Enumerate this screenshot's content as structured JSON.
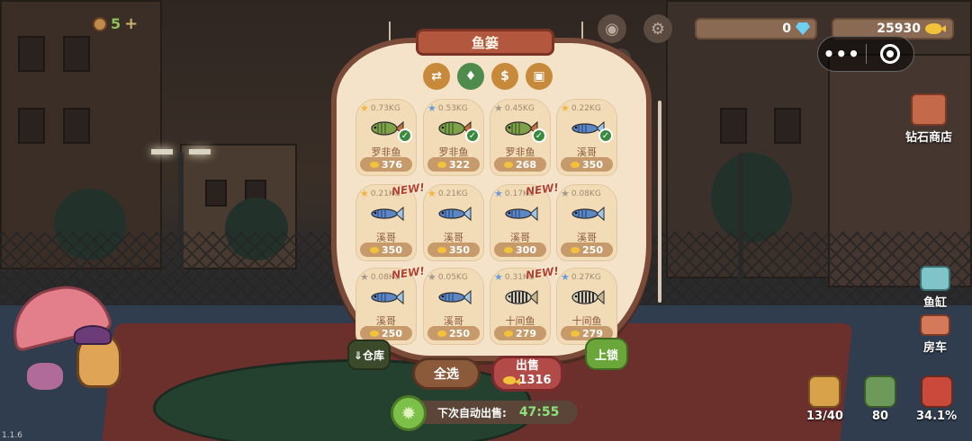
{
  "hud": {
    "cookie_count": "5",
    "plus": "+",
    "diamonds": "0",
    "coins": "25930",
    "help": "?",
    "capsule_menu": "•••"
  },
  "panel": {
    "title": "鱼篓",
    "tools": [
      {
        "icon": "swap-icon",
        "glyph": "⇄"
      },
      {
        "icon": "diamond-filter-icon",
        "glyph": "♦"
      },
      {
        "icon": "coin-filter-icon",
        "glyph": "$"
      },
      {
        "icon": "bag-filter-icon",
        "glyph": "▣"
      }
    ]
  },
  "fish": [
    {
      "weight": "0.73KG",
      "name": "罗非鱼",
      "price": "376",
      "checked": true,
      "new": false,
      "star": "gold",
      "kind": "tilapia"
    },
    {
      "weight": "0.53KG",
      "name": "罗非鱼",
      "price": "322",
      "checked": true,
      "new": false,
      "star": "blue",
      "kind": "tilapia"
    },
    {
      "weight": "0.45KG",
      "name": "罗非鱼",
      "price": "268",
      "checked": true,
      "new": false,
      "star": "gray",
      "kind": "tilapia"
    },
    {
      "weight": "0.22KG",
      "name": "溪哥",
      "price": "350",
      "checked": true,
      "new": false,
      "star": "gold",
      "kind": "creek"
    },
    {
      "weight": "0.21KG",
      "name": "溪哥",
      "price": "350",
      "checked": false,
      "new": true,
      "star": "gold",
      "kind": "creek"
    },
    {
      "weight": "0.21KG",
      "name": "溪哥",
      "price": "350",
      "checked": false,
      "new": false,
      "star": "gold",
      "kind": "creek"
    },
    {
      "weight": "0.17KG",
      "name": "溪哥",
      "price": "300",
      "checked": false,
      "new": true,
      "star": "blue",
      "kind": "creek"
    },
    {
      "weight": "0.08KG",
      "name": "溪哥",
      "price": "250",
      "checked": false,
      "new": false,
      "star": "gray",
      "kind": "creek"
    },
    {
      "weight": "0.08KG",
      "name": "溪哥",
      "price": "250",
      "checked": false,
      "new": true,
      "star": "gray",
      "kind": "creek"
    },
    {
      "weight": "0.05KG",
      "name": "溪哥",
      "price": "250",
      "checked": false,
      "new": false,
      "star": "gray",
      "kind": "creek"
    },
    {
      "weight": "0.31KG",
      "name": "十间鱼",
      "price": "279",
      "checked": false,
      "new": true,
      "star": "blue",
      "kind": "striped"
    },
    {
      "weight": "0.27KG",
      "name": "十间鱼",
      "price": "279",
      "checked": false,
      "new": false,
      "star": "blue",
      "kind": "striped"
    }
  ],
  "labels": {
    "new": "NEW!",
    "store": "⇓仓库",
    "select_all": "全选",
    "sell": "出售",
    "sell_amount": "1316",
    "lock": "上锁",
    "auto_sell": "下次自动出售:",
    "auto_time": "47:55"
  },
  "side": {
    "diamond_shop": "钻石商店",
    "fish_tank": "鱼缸",
    "cart": "房车"
  },
  "stats": {
    "backpack": "13/40",
    "green_item": "80",
    "progress": "34.1%"
  },
  "version": "1.1.6",
  "colors": {
    "panel_bg": "#f4e3c8",
    "panel_border": "#7a4b39",
    "title_banner": "#b3583f",
    "sell_button": "#b24a48",
    "lock_button": "#6aa63a",
    "timer": "#8fe07a"
  }
}
